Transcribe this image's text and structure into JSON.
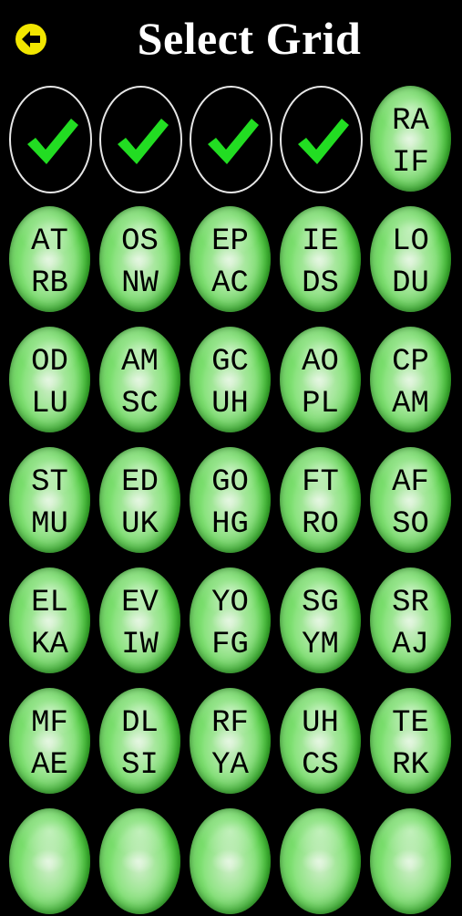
{
  "header": {
    "title": "Select Grid",
    "back_icon": "arrow-left-icon",
    "back_color": "#f2e600"
  },
  "grid": {
    "completed_icon": "checkmark-icon",
    "check_color": "#22dd22",
    "button_color": "#4fd73a",
    "cells": [
      {
        "state": "completed",
        "line1": "",
        "line2": ""
      },
      {
        "state": "completed",
        "line1": "",
        "line2": ""
      },
      {
        "state": "completed",
        "line1": "",
        "line2": ""
      },
      {
        "state": "completed",
        "line1": "",
        "line2": ""
      },
      {
        "state": "available",
        "line1": "RA",
        "line2": "IF"
      },
      {
        "state": "available",
        "line1": "AT",
        "line2": "RB"
      },
      {
        "state": "available",
        "line1": "OS",
        "line2": "NW"
      },
      {
        "state": "available",
        "line1": "EP",
        "line2": "AC"
      },
      {
        "state": "available",
        "line1": "IE",
        "line2": "DS"
      },
      {
        "state": "available",
        "line1": "LO",
        "line2": "DU"
      },
      {
        "state": "available",
        "line1": "OD",
        "line2": "LU"
      },
      {
        "state": "available",
        "line1": "AM",
        "line2": "SC"
      },
      {
        "state": "available",
        "line1": "GC",
        "line2": "UH"
      },
      {
        "state": "available",
        "line1": "AO",
        "line2": "PL"
      },
      {
        "state": "available",
        "line1": "CP",
        "line2": "AM"
      },
      {
        "state": "available",
        "line1": "ST",
        "line2": "MU"
      },
      {
        "state": "available",
        "line1": "ED",
        "line2": "UK"
      },
      {
        "state": "available",
        "line1": "GO",
        "line2": "HG"
      },
      {
        "state": "available",
        "line1": "FT",
        "line2": "RO"
      },
      {
        "state": "available",
        "line1": "AF",
        "line2": "SO"
      },
      {
        "state": "available",
        "line1": "EL",
        "line2": "KA"
      },
      {
        "state": "available",
        "line1": "EV",
        "line2": "IW"
      },
      {
        "state": "available",
        "line1": "YO",
        "line2": "FG"
      },
      {
        "state": "available",
        "line1": "SG",
        "line2": "YM"
      },
      {
        "state": "available",
        "line1": "SR",
        "line2": "AJ"
      },
      {
        "state": "available",
        "line1": "MF",
        "line2": "AE"
      },
      {
        "state": "available",
        "line1": "DL",
        "line2": "SI"
      },
      {
        "state": "available",
        "line1": "RF",
        "line2": "YA"
      },
      {
        "state": "available",
        "line1": "UH",
        "line2": "CS"
      },
      {
        "state": "available",
        "line1": "TE",
        "line2": "RK"
      },
      {
        "state": "available",
        "line1": "",
        "line2": ""
      },
      {
        "state": "available",
        "line1": "",
        "line2": ""
      },
      {
        "state": "available",
        "line1": "",
        "line2": ""
      },
      {
        "state": "available",
        "line1": "",
        "line2": ""
      },
      {
        "state": "available",
        "line1": "",
        "line2": ""
      }
    ]
  }
}
